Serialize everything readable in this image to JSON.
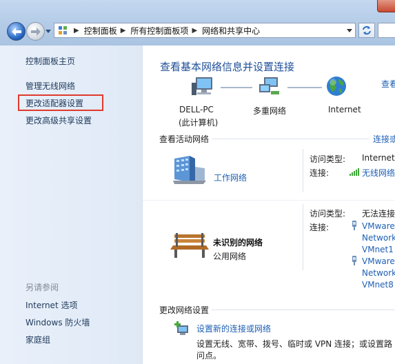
{
  "window": {
    "breadcrumb": [
      "控制面板",
      "所有控制面板项",
      "网络和共享中心"
    ]
  },
  "sidebar": {
    "home": "控制面板主页",
    "items": [
      "管理无线网络",
      "更改适配器设置",
      "更改高级共享设置"
    ],
    "see_also_heading": "另请参阅",
    "see_also": [
      "Internet 选项",
      "Windows 防火墙",
      "家庭组"
    ]
  },
  "main": {
    "title": "查看基本网络信息并设置连接",
    "see_full_map": "查看",
    "map": {
      "computer_name": "DELL-PC",
      "computer_sub": "(此计算机)",
      "network": "多重网络",
      "internet": "Internet"
    },
    "active_networks_header": "查看活动网络",
    "connect_disconnect": "连接或",
    "networks": [
      {
        "name": "工作网络",
        "type": "",
        "access_label": "访问类型:",
        "access_value": "Internet",
        "conn_label": "连接:",
        "conn_values": [
          "无线网络"
        ]
      },
      {
        "name": "未识别的网络",
        "type": "公用网络",
        "access_label": "访问类型:",
        "access_value": "无法连接",
        "conn_label": "连接:",
        "conn_values": [
          "VMware",
          "Network",
          "VMnet1",
          "VMware",
          "Network",
          "VMnet8"
        ]
      }
    ],
    "change_settings_header": "更改网络设置",
    "setup_link": "设置新的连接或网络",
    "setup_desc_1": "设置无线、宽带、拨号、临时或 VPN 连接；或设置路",
    "setup_desc_2": "问点。"
  },
  "colors": {
    "accent_link": "#1e5fb4",
    "title_blue": "#1e4e9a",
    "highlight_red": "#e0392b",
    "sidebar_bg": "#e4edf8"
  }
}
